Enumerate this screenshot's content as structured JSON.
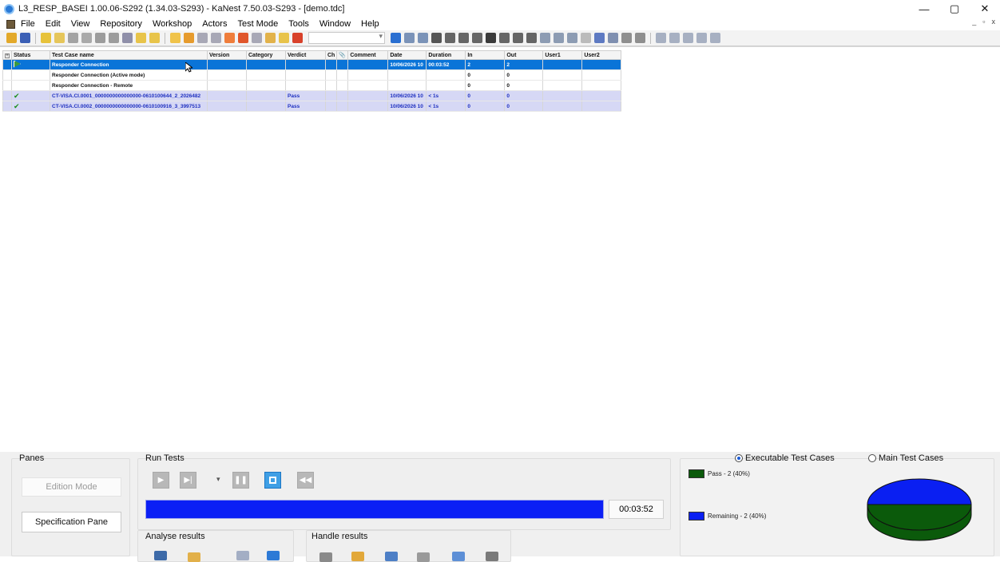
{
  "window": {
    "title": "L3_RESP_BASEI 1.00.06-S292 (1.34.03-S293)  -  KaNest 7.50.03-S293 - [demo.tdc]",
    "minimize": "—",
    "maximize": "▢",
    "close": "✕"
  },
  "menu": {
    "items": [
      "File",
      "Edit",
      "View",
      "Repository",
      "Workshop",
      "Actors",
      "Test Mode",
      "Tools",
      "Window",
      "Help"
    ],
    "mdi_minimize": "_",
    "mdi_restore": "▫",
    "mdi_close": "x"
  },
  "toolbar": {
    "combo_value": ""
  },
  "grid": {
    "columns": [
      "Status",
      "Test Case name",
      "Version",
      "Category",
      "Verdict",
      "Ch",
      "",
      "Comment",
      "Date",
      "Duration",
      "In",
      "Out",
      "User1",
      "User2"
    ],
    "rows": [
      {
        "status": "arrow",
        "name": "Responder Connection",
        "version": "",
        "category": "",
        "verdict": "",
        "ch": "",
        "att": "",
        "comment": "",
        "date": "10/06/2026 10",
        "duration": "00:03:52",
        "in": "2",
        "out": "2",
        "user1": "",
        "user2": "",
        "style": "selected"
      },
      {
        "status": "",
        "name": "Responder Connection (Active mode)",
        "version": "",
        "category": "",
        "verdict": "",
        "ch": "",
        "att": "",
        "comment": "",
        "date": "",
        "duration": "",
        "in": "0",
        "out": "0",
        "user1": "",
        "user2": "",
        "style": "plain"
      },
      {
        "status": "",
        "name": "Responder Connection - Remote",
        "version": "",
        "category": "",
        "verdict": "",
        "ch": "",
        "att": "",
        "comment": "",
        "date": "",
        "duration": "",
        "in": "0",
        "out": "0",
        "user1": "",
        "user2": "",
        "style": "plain"
      },
      {
        "status": "check",
        "name": "CT-VISA.CI.0001_0000000000000000-0610100644_2_2026482",
        "version": "",
        "category": "",
        "verdict": "Pass",
        "ch": "",
        "att": "",
        "comment": "",
        "date": "10/06/2026 10",
        "duration": "< 1s",
        "in": "0",
        "out": "0",
        "user1": "",
        "user2": "",
        "style": "pass"
      },
      {
        "status": "check",
        "name": "CT-VISA.CI.0002_0000000000000000-0610100916_3_3997513",
        "version": "",
        "category": "",
        "verdict": "Pass",
        "ch": "",
        "att": "",
        "comment": "",
        "date": "10/06/2026 10",
        "duration": "< 1s",
        "in": "0",
        "out": "0",
        "user1": "",
        "user2": "",
        "style": "pass"
      }
    ]
  },
  "panes": {
    "title": "Panes",
    "edition_mode": "Edition Mode",
    "specification_pane": "Specification Pane"
  },
  "run_tests": {
    "title": "Run Tests",
    "progress_fraction": 1.0,
    "elapsed": "00:03:52"
  },
  "analyse": {
    "title": "Analyse results"
  },
  "handle": {
    "title": "Handle results"
  },
  "stats": {
    "executable_label": "Executable Test Cases",
    "main_label": "Main Test Cases",
    "selected": "executable",
    "legend": [
      {
        "label": "Pass - 2 (40%)",
        "color": "#0b5a0b"
      },
      {
        "label": "Remaining - 2 (40%)",
        "color": "#0a1ff2"
      }
    ],
    "pie_colors": {
      "top": "#0a1ff2",
      "bottom": "#0b5a0b"
    }
  }
}
